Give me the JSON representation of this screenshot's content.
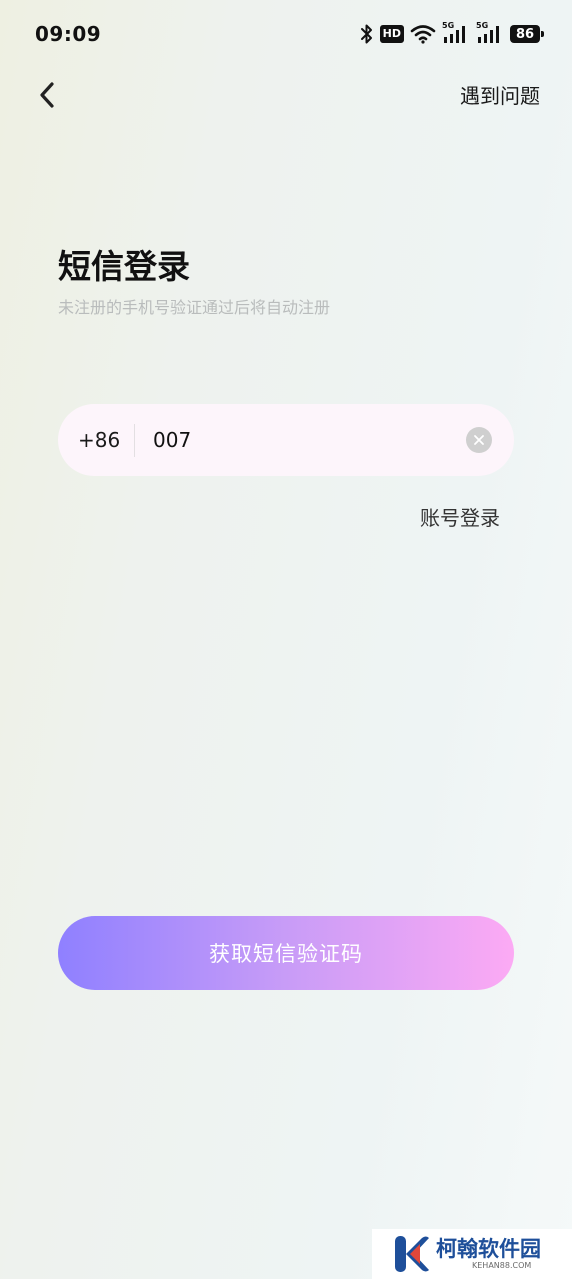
{
  "status_bar": {
    "time": "09:09",
    "hd_label": "HD",
    "network_1": "5G",
    "network_2": "5G",
    "battery": "86",
    "icons": [
      "bluetooth-icon",
      "hd-icon",
      "wifi-icon",
      "signal-5g-icon",
      "signal-5g-icon",
      "battery-icon"
    ]
  },
  "header": {
    "back_icon": "chevron-left-icon",
    "help_label": "遇到问题"
  },
  "main": {
    "title": "短信登录",
    "subtitle": "未注册的手机号验证通过后将自动注册",
    "phone": {
      "country_code": "+86",
      "value": "007",
      "clear_icon": "close-circle-icon"
    },
    "account_login_label": "账号登录",
    "submit_label": "获取短信验证码"
  },
  "watermark": {
    "title": "柯翰软件园",
    "subtitle": "KEHAN88.COM"
  },
  "colors": {
    "button_gradient_start": "#8f80ff",
    "button_gradient_end": "#fcaaf4",
    "input_background": "#fdf5fb",
    "subtitle_text": "#b9bcbc",
    "watermark_blue": "#1e4f9a"
  }
}
